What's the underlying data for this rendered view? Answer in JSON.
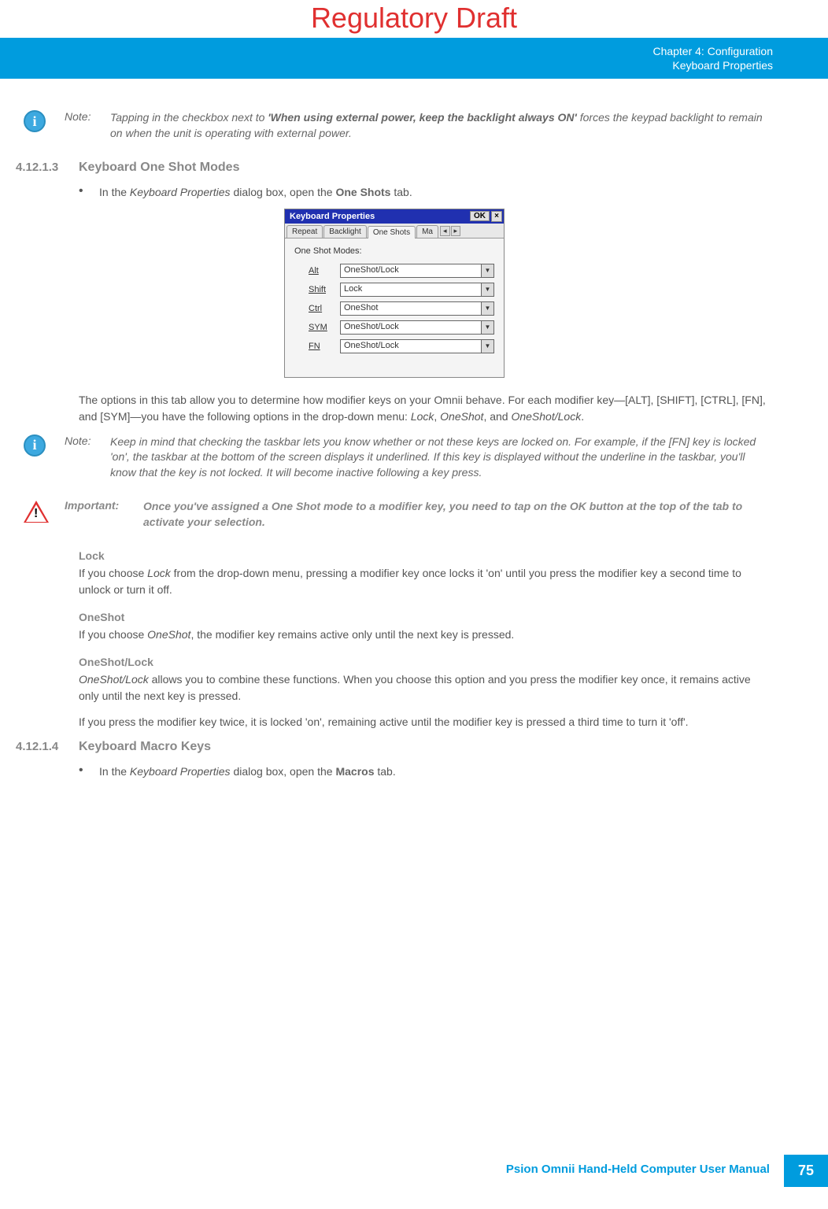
{
  "draft_label": "Regulatory Draft",
  "header": {
    "chapter": "Chapter 4:  Configuration",
    "section": "Keyboard Properties"
  },
  "note1": {
    "label": "Note:",
    "text_pre": "Tapping in the checkbox next to ",
    "bold": "'When using external power, keep the backlight always ON'",
    "text_post": " forces the keypad backlight to remain on when the unit is operating with external power."
  },
  "sec_4_12_1_3": {
    "num": "4.12.1.3",
    "title": "Keyboard One Shot Modes",
    "bullet_pre": "In the ",
    "bullet_ital": "Keyboard Properties",
    "bullet_mid": " dialog box, open the ",
    "bullet_bold": "One Shots",
    "bullet_post": " tab."
  },
  "dialog": {
    "title": "Keyboard Properties",
    "ok": "OK",
    "close": "×",
    "tabs": {
      "t1": "Repeat",
      "t2": "Backlight",
      "t3": "One Shots",
      "t4": "Ma"
    },
    "group_label": "One Shot Modes:",
    "rows": [
      {
        "label": "Alt",
        "value": "OneShot/Lock"
      },
      {
        "label": "Shift",
        "value": "Lock"
      },
      {
        "label": "Ctrl",
        "value": "OneShot"
      },
      {
        "label": "SYM",
        "value": "OneShot/Lock"
      },
      {
        "label": "FN",
        "value": "OneShot/Lock"
      }
    ]
  },
  "para_after_dialog": {
    "p1": "The options in this tab allow you to determine how modifier keys on your Omnii behave. For each modifier key—[ALT], [SHIFT], [CTRL], [FN], and [SYM]—you have the following options in the drop-down menu: ",
    "i1": "Lock",
    "p2": ", ",
    "i2": "OneShot",
    "p3": ", and ",
    "i3": "OneShot/Lock",
    "p4": "."
  },
  "note2": {
    "label": "Note:",
    "text": "Keep in mind that checking the taskbar lets you know whether or not these keys are locked on. For example, if the [FN] key is locked 'on', the taskbar at the bottom of the screen displays it underlined. If this key is displayed without the underline in the taskbar, you'll know that the key is not locked. It will become inactive following a key press."
  },
  "important1": {
    "label": "Important:",
    "text": "Once you've assigned a One Shot mode to a modifier key, you need to tap on the OK button at the top of the tab to activate your selection."
  },
  "lock": {
    "h": "Lock",
    "pre": "If you choose ",
    "i": "Lock",
    "post": " from the drop-down menu, pressing a modifier key once locks it 'on' until you press the modifier key a second time to unlock or turn it off."
  },
  "oneshot": {
    "h": "OneShot",
    "pre": "If you choose ",
    "i": "OneShot",
    "post": ", the modifier key remains active only until the next key is pressed."
  },
  "oneshotlock": {
    "h": "OneShot/Lock",
    "i1": "OneShot/Lock",
    "p1": " allows you to combine these functions. When you choose this option and you press the modifier key once, it remains active only until the next key is pressed.",
    "p2": "If you press the modifier key twice, it is locked 'on', remaining active until the modifier key is pressed a third time to turn it 'off'."
  },
  "sec_4_12_1_4": {
    "num": "4.12.1.4",
    "title": "Keyboard Macro Keys",
    "bullet_pre": "In the ",
    "bullet_ital": "Keyboard Properties",
    "bullet_mid": " dialog box, open the ",
    "bullet_bold": "Macros",
    "bullet_post": " tab."
  },
  "footer": {
    "manual": "Psion Omnii Hand-Held Computer User Manual",
    "page": "75"
  },
  "glyphs": {
    "i": "i",
    "bang": "!",
    "down": "▼",
    "left": "◂",
    "right": "▸",
    "bullet": "•"
  }
}
